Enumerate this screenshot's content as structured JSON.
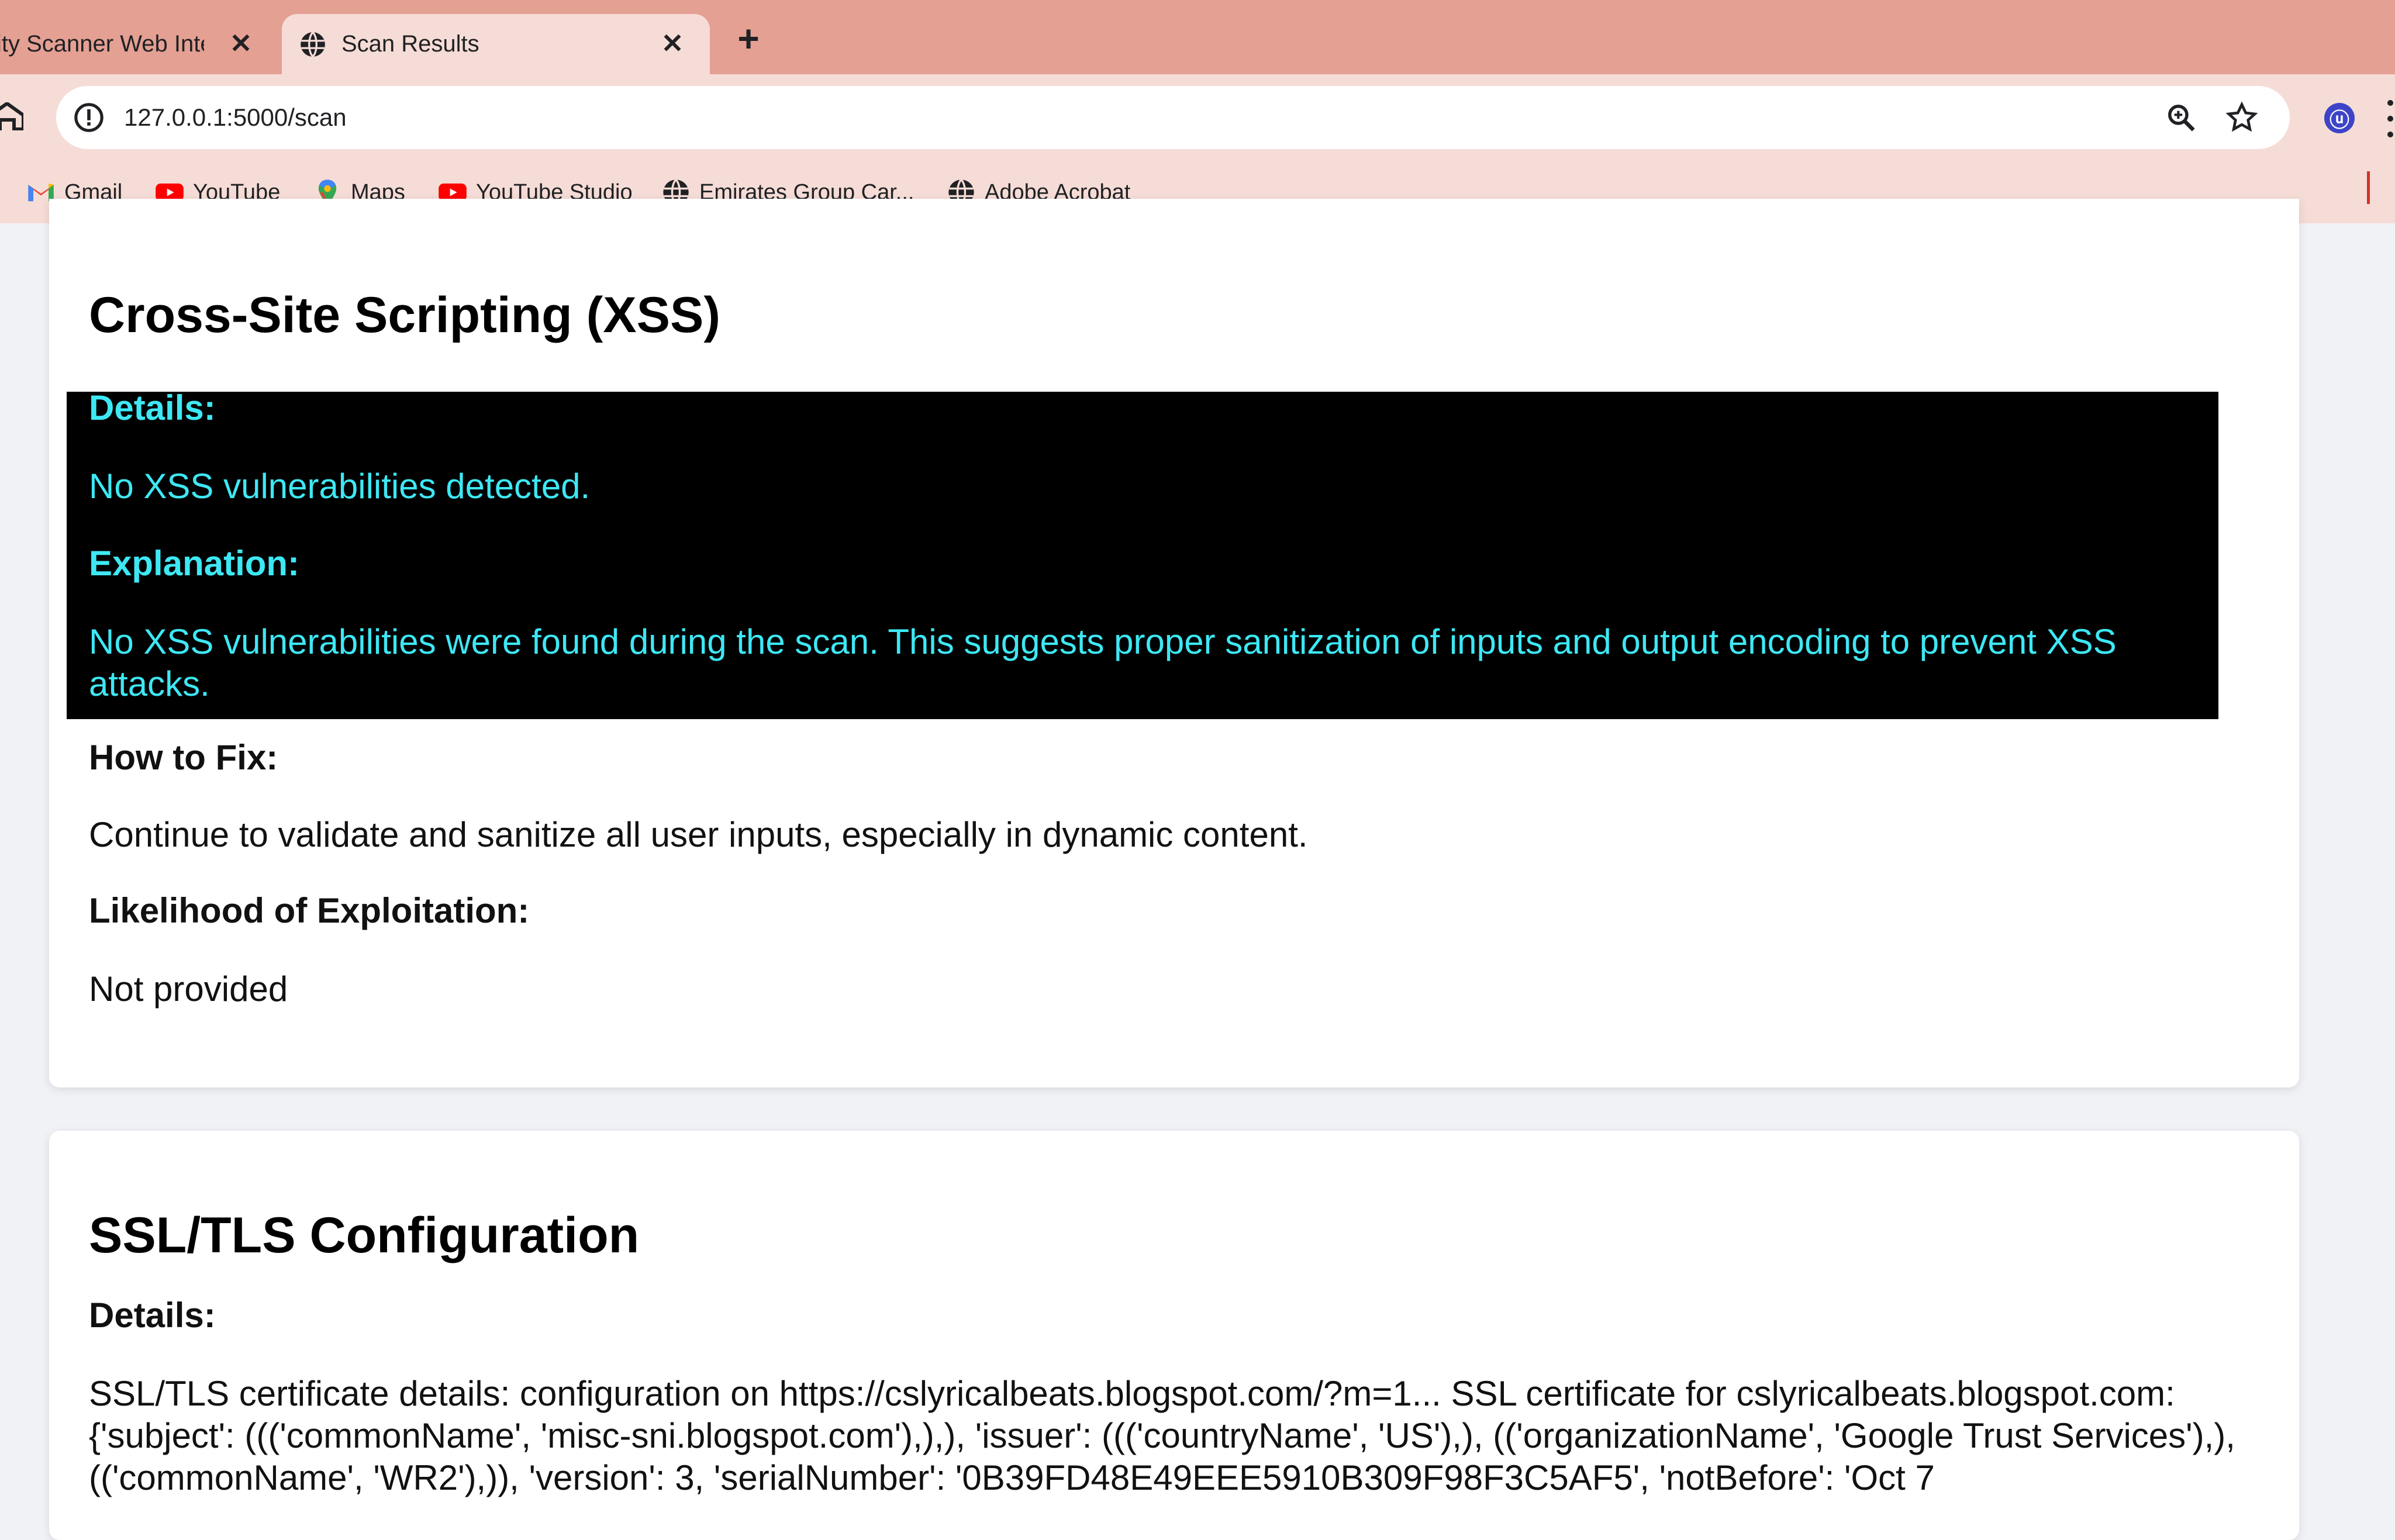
{
  "browser": {
    "tabs": [
      {
        "title": "ity Scanner Web Integ",
        "active": false
      },
      {
        "title": "Scan Results",
        "active": true
      }
    ],
    "url": "127.0.0.1:5000/scan",
    "bookmarks": [
      {
        "label": "Gmail",
        "icon": "gmail-icon"
      },
      {
        "label": "YouTube",
        "icon": "youtube-icon"
      },
      {
        "label": "Maps",
        "icon": "maps-icon"
      },
      {
        "label": "YouTube Studio",
        "icon": "youtube-icon"
      },
      {
        "label": "Emirates Group Car...",
        "icon": "globe-icon"
      },
      {
        "label": "Adobe Acrobat",
        "icon": "globe-icon"
      }
    ]
  },
  "sections": [
    {
      "title": "Cross-Site Scripting (XSS)",
      "details_heading": "Details:",
      "details": "No XSS vulnerabilities detected.",
      "explanation_heading": "Explanation:",
      "explanation": "No XSS vulnerabilities were found during the scan. This suggests proper sanitization of inputs and output encoding to prevent XSS attacks.",
      "fix_heading": "How to Fix:",
      "fix": "Continue to validate and sanitize all user inputs, especially in dynamic content.",
      "likelihood_heading": "Likelihood of Exploitation:",
      "likelihood": "Not provided"
    },
    {
      "title": "SSL/TLS Configuration",
      "details_heading": "Details:",
      "details": "SSL/TLS certificate details: configuration on https://cslyricalbeats.blogspot.com/?m=1... SSL certificate for cslyricalbeats.blogspot.com: {'subject': ((('commonName', 'misc-sni.blogspot.com'),),), 'issuer': ((('countryName', 'US'),), (('organizationName', 'Google Trust Services'),), (('commonName', 'WR2'),)), 'version': 3, 'serialNumber': '0B39FD48E49EEE5910B309F98F3C5AF5', 'notBefore': 'Oct 7"
    }
  ],
  "colors": {
    "tab_strip": "#e4a093",
    "toolbar": "#f6dcd6",
    "highlight_bg": "#000000",
    "highlight_text": "#3de8f4"
  }
}
